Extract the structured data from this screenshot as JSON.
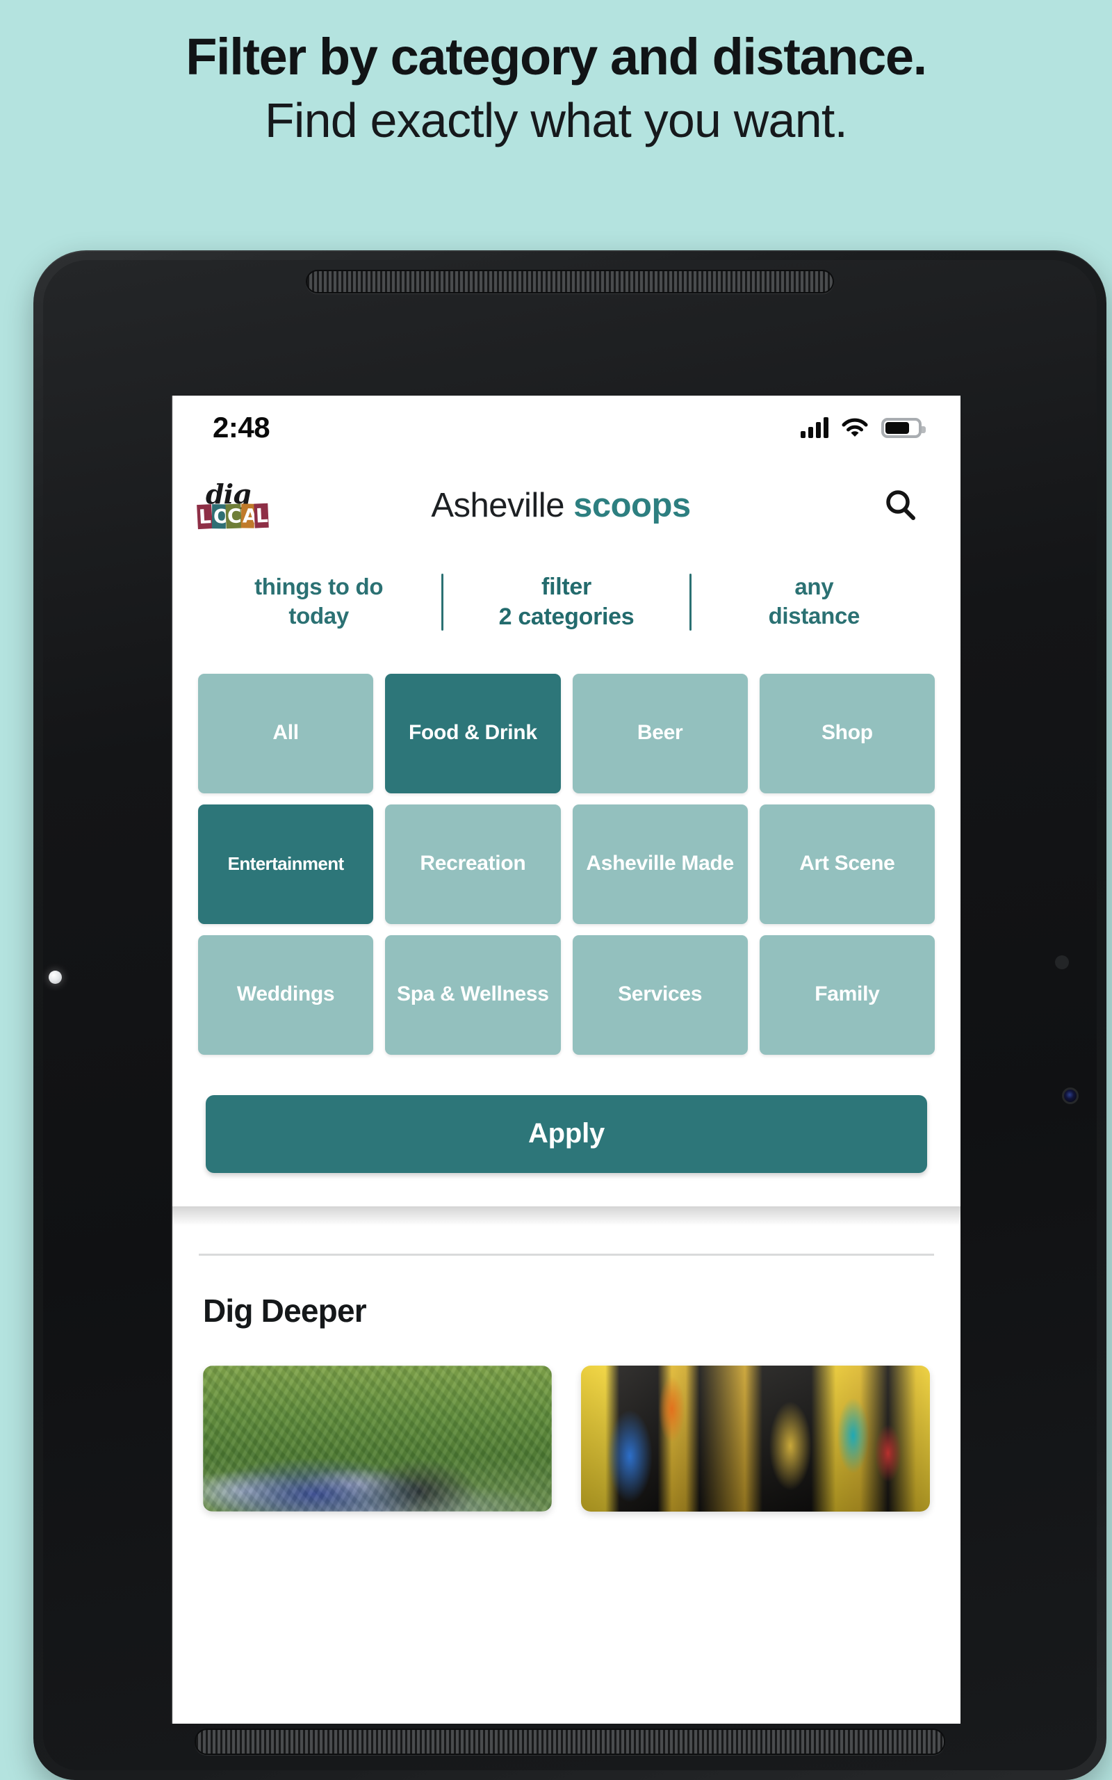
{
  "headline": {
    "line1": "Filter by category and distance.",
    "line2": "Find exactly what you want."
  },
  "colors": {
    "page_background": "#b4e3df",
    "accent_teal": "#2d7679",
    "tile_unselected": "#93c0be",
    "tile_selected": "#2d7679",
    "text_dark": "#15181a"
  },
  "status_bar": {
    "time": "2:48",
    "signal_icon": "cellular-signal-icon",
    "wifi_icon": "wifi-icon",
    "battery_icon": "battery-icon"
  },
  "app_header": {
    "logo_top": "dig",
    "logo_bottom_letters": [
      "L",
      "O",
      "C",
      "A",
      "L"
    ],
    "title_regular": "Asheville",
    "title_bold": "scoops",
    "search_icon": "search-icon"
  },
  "filter_bar": {
    "tabs": [
      {
        "line1": "things to do",
        "line2": "today",
        "active": false
      },
      {
        "line1": "filter",
        "line2": "2 categories",
        "active": true
      },
      {
        "line1": "any",
        "line2": "distance",
        "active": false
      }
    ]
  },
  "categories": [
    {
      "label": "All",
      "selected": false
    },
    {
      "label": "Food & Drink",
      "selected": true
    },
    {
      "label": "Beer",
      "selected": false
    },
    {
      "label": "Shop",
      "selected": false
    },
    {
      "label": "Entertainment",
      "selected": true
    },
    {
      "label": "Recreation",
      "selected": false
    },
    {
      "label": "Asheville Made",
      "selected": false
    },
    {
      "label": "Art Scene",
      "selected": false
    },
    {
      "label": "Weddings",
      "selected": false
    },
    {
      "label": "Spa & Wellness",
      "selected": false
    },
    {
      "label": "Services",
      "selected": false
    },
    {
      "label": "Family",
      "selected": false
    }
  ],
  "apply": {
    "label": "Apply"
  },
  "dig_deeper": {
    "title": "Dig Deeper",
    "cards": [
      {
        "image_alt": "outdoor-festival-green-hillside-photo"
      },
      {
        "image_alt": "colorful-shop-interior-yellow-photo"
      }
    ]
  }
}
